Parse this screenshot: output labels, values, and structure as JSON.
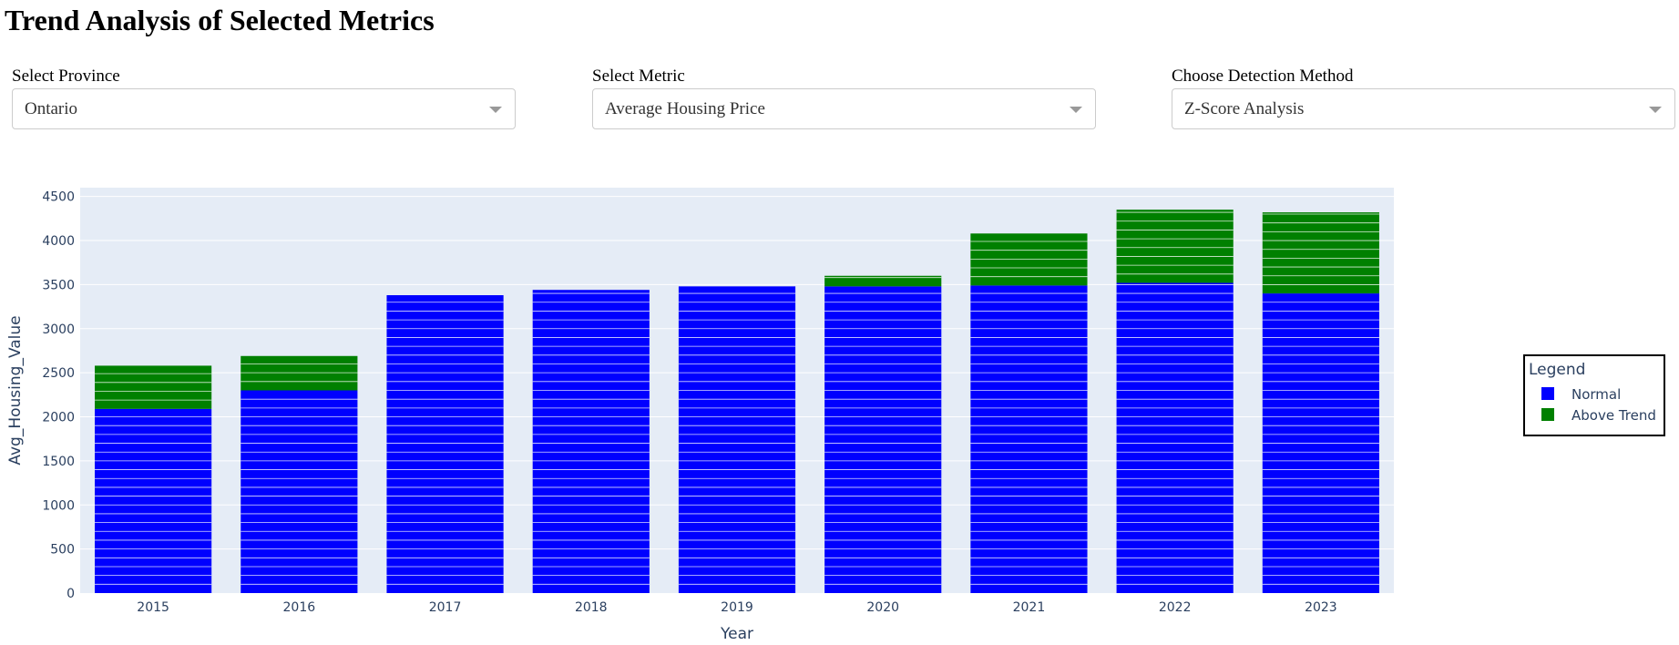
{
  "page": {
    "title": "Trend Analysis of Selected Metrics"
  },
  "controls": {
    "province": {
      "label": "Select Province",
      "value": "Ontario"
    },
    "metric": {
      "label": "Select Metric",
      "value": "Average Housing Price"
    },
    "method": {
      "label": "Choose Detection Method",
      "value": "Z-Score Analysis"
    }
  },
  "colors": {
    "normal": "#0000ff",
    "above_trend": "#008000",
    "plot_bg": "#e5ecf6",
    "axis_text": "#2a3f5f"
  },
  "chart_data": {
    "type": "bar",
    "barmode": "stack",
    "xlabel": "Year",
    "ylabel": "Avg_Housing_Value",
    "ylim": [
      0,
      4600
    ],
    "yticks": [
      0,
      500,
      1000,
      1500,
      2000,
      2500,
      3000,
      3500,
      4000,
      4500
    ],
    "grid": true,
    "legend": {
      "title": "Legend",
      "placement": "right"
    },
    "categories": [
      "2015",
      "2016",
      "2017",
      "2018",
      "2019",
      "2020",
      "2021",
      "2022",
      "2023"
    ],
    "series": [
      {
        "name": "Normal",
        "color": "#0000ff",
        "values": [
          2090,
          2300,
          3380,
          3440,
          3480,
          3480,
          3490,
          3520,
          3400
        ]
      },
      {
        "name": "Above Trend",
        "color": "#008000",
        "values": [
          490,
          390,
          0,
          0,
          0,
          120,
          590,
          830,
          920
        ]
      }
    ]
  }
}
